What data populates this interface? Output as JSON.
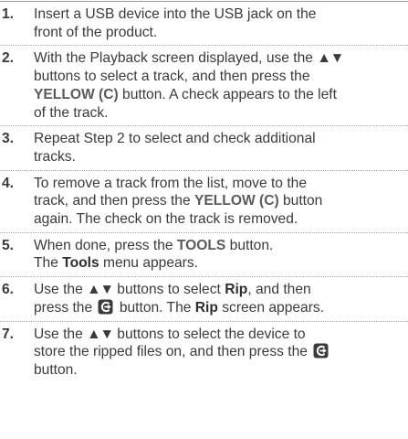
{
  "steps": [
    {
      "number": "1.",
      "lines": [
        "Insert a USB device into the USB jack on the",
        "front of the product."
      ]
    },
    {
      "number": "2.",
      "l1": "With the Playback screen displayed, use the ",
      "arrows": "▲▼",
      "l2": "buttons to select a track, and then press the",
      "l3_key": "YELLOW (C)",
      "l3_rest": " button. A check appears to the left",
      "l4": "of the track."
    },
    {
      "number": "3.",
      "lines": [
        "Repeat Step 2 to select and check additional",
        "tracks."
      ]
    },
    {
      "number": "4.",
      "l1": "To remove a track from the list, move to the",
      "l2_pre": "track, and then press the ",
      "l2_key": "YELLOW (C)",
      "l2_post": " button",
      "l3": "again. The check on the track is removed."
    },
    {
      "number": "5.",
      "l1_pre": "When done, press the ",
      "l1_key": "TOOLS",
      "l1_post": " button.",
      "l2_pre": "The ",
      "l2_key": "Tools",
      "l2_post": " menu appears."
    },
    {
      "number": "6.",
      "l1_pre": "Use the ",
      "arrows": "▲▼",
      "l1_mid": " buttons to select ",
      "l1_key": "Rip",
      "l1_post": ", and then",
      "l2_pre": "press the ",
      "l2_mid": " button. The ",
      "l2_key": "Rip",
      "l2_post": " screen appears."
    },
    {
      "number": "7.",
      "l1_pre": "Use the ",
      "arrows": "▲▼",
      "l1_post": " buttons to select the device to",
      "l2": "store the ripped files on, and then press the ",
      "l3": "button."
    }
  ],
  "icons": {
    "enter": "enter-button-icon",
    "enter_color": "#3a3a3a"
  }
}
